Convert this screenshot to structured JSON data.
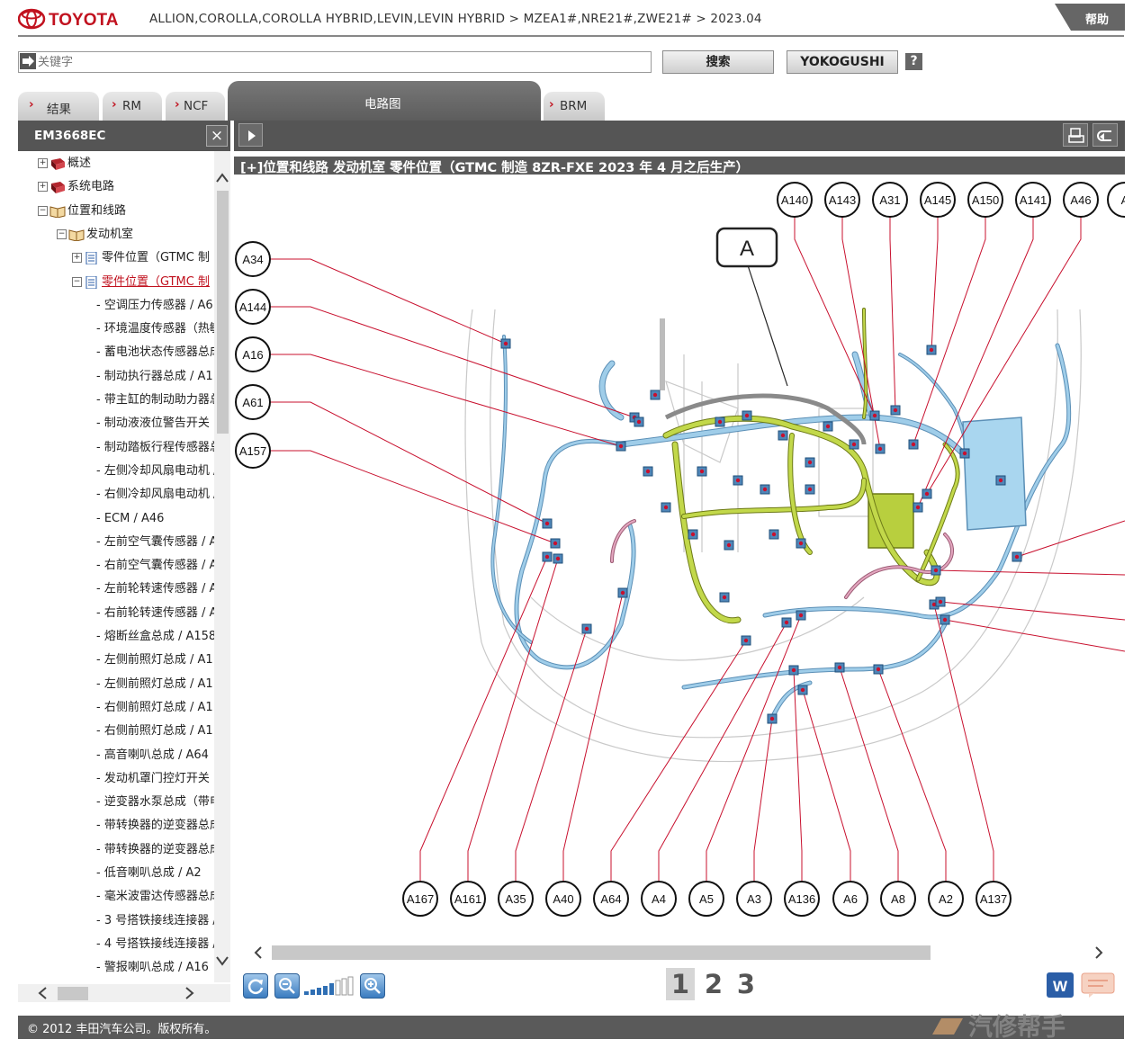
{
  "header": {
    "brand": "TOYOTA",
    "breadcrumb": "ALLION,COROLLA,COROLLA HYBRID,LEVIN,LEVIN HYBRID > MZEA1#,NRE21#,ZWE21# > 2023.04",
    "help_label": "帮助"
  },
  "search": {
    "placeholder": "关键字",
    "search_label": "搜索",
    "yokogushi_label": "YOKOGUSHI",
    "help_q": "?"
  },
  "tabs": [
    {
      "label": "结果"
    },
    {
      "label": "RM"
    },
    {
      "label": "NCF"
    },
    {
      "label": "电路图",
      "active": true
    },
    {
      "label": "BRM"
    }
  ],
  "left_panel": {
    "title": "EM3668EC",
    "close_icon": "×",
    "tree": [
      {
        "label": "概述",
        "level": 0,
        "toggle": "+"
      },
      {
        "label": "系统电路",
        "level": 0,
        "toggle": "+"
      },
      {
        "label": "位置和线路",
        "level": 0,
        "toggle": "−"
      },
      {
        "label": "发动机室",
        "level": 1,
        "toggle": "−"
      },
      {
        "label": "零件位置（GTMC 制",
        "level": 2,
        "toggle": "+"
      },
      {
        "label": "零件位置（GTMC 制",
        "level": 2,
        "toggle": "−",
        "selected": true
      },
      {
        "label": "- 空调压力传感器 / A6",
        "level": 3
      },
      {
        "label": "- 环境温度传感器（热敏",
        "level": 3
      },
      {
        "label": "- 蓄电池状态传感器总成",
        "level": 3
      },
      {
        "label": "- 制动执行器总成 / A1",
        "level": 3
      },
      {
        "label": "- 带主缸的制动助力器总",
        "level": 3
      },
      {
        "label": "- 制动液液位警告开关",
        "level": 3
      },
      {
        "label": "- 制动踏板行程传感器总",
        "level": 3
      },
      {
        "label": "- 左侧冷却风扇电动机 /",
        "level": 3
      },
      {
        "label": "- 右侧冷却风扇电动机 /",
        "level": 3
      },
      {
        "label": "- ECM / A46",
        "level": 3
      },
      {
        "label": "- 左前空气囊传感器 / A",
        "level": 3
      },
      {
        "label": "- 右前空气囊传感器 / A",
        "level": 3
      },
      {
        "label": "- 左前轮转速传感器 / A",
        "level": 3
      },
      {
        "label": "- 右前轮转速传感器 / A",
        "level": 3
      },
      {
        "label": "- 熔断丝盒总成 / A158",
        "level": 3
      },
      {
        "label": "- 左侧前照灯总成 / A1",
        "level": 3
      },
      {
        "label": "- 左侧前照灯总成 / A1",
        "level": 3
      },
      {
        "label": "- 右侧前照灯总成 / A1",
        "level": 3
      },
      {
        "label": "- 右侧前照灯总成 / A1",
        "level": 3
      },
      {
        "label": "- 高音喇叭总成 / A64",
        "level": 3
      },
      {
        "label": "- 发动机罩门控灯开关",
        "level": 3
      },
      {
        "label": "- 逆变器水泵总成（带电",
        "level": 3
      },
      {
        "label": "- 带转换器的逆变器总成",
        "level": 3
      },
      {
        "label": "- 带转换器的逆变器总成",
        "level": 3
      },
      {
        "label": "- 低音喇叭总成 / A2",
        "level": 3
      },
      {
        "label": "- 毫米波雷达传感器总成",
        "level": 3
      },
      {
        "label": "- 3 号搭铁接线连接器 /",
        "level": 3
      },
      {
        "label": "- 4 号搭铁接线连接器 /",
        "level": 3
      },
      {
        "label": "- 警报喇叭总成 / A16",
        "level": 3
      }
    ]
  },
  "figure": {
    "title": "[+]位置和线路  发动机室  零件位置（GTMC 制造 8ZR-FXE 2023 年 4 月之后生产）",
    "callout_big": "A",
    "top_labels": [
      "A140",
      "A143",
      "A31",
      "A145",
      "A150",
      "A141",
      "A46",
      "A"
    ],
    "left_labels": [
      "A34",
      "A144",
      "A16",
      "A61",
      "A157"
    ],
    "bottom_labels": [
      "A167",
      "A161",
      "A35",
      "A40",
      "A64",
      "A4",
      "A5",
      "A3",
      "A136",
      "A6",
      "A8",
      "A2",
      "A137"
    ]
  },
  "pager": {
    "pages": [
      "1",
      "2",
      "3"
    ],
    "current": "1"
  },
  "footer": {
    "copyright": "© 2012 丰田汽车公司。版权所有。",
    "watermark": "汽修帮手"
  },
  "colors": {
    "brand_red": "#c1121f",
    "header_dark": "#555555",
    "harness_blue": "#8fc4e6",
    "harness_green": "#b6cc3a",
    "leader_red": "#c8102e"
  }
}
